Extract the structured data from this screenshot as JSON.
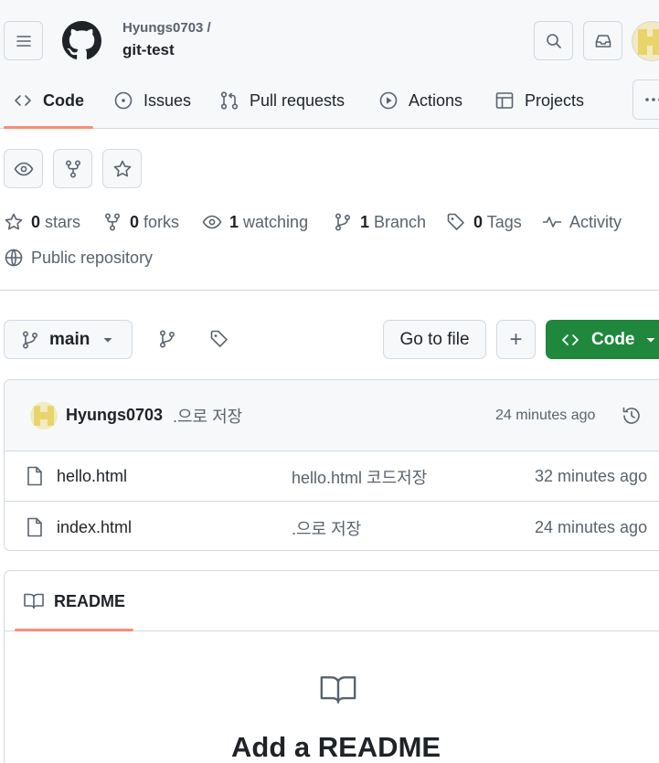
{
  "header": {
    "owner": "Hyungs0703 /",
    "repo": "git-test"
  },
  "tabs": [
    {
      "label": "Code",
      "icon": "code-icon",
      "selected": true
    },
    {
      "label": "Issues",
      "icon": "issue-opened-icon"
    },
    {
      "label": "Pull requests",
      "icon": "git-pull-request-icon"
    },
    {
      "label": "Actions",
      "icon": "play-icon"
    },
    {
      "label": "Projects",
      "icon": "table-icon"
    }
  ],
  "stats": {
    "stars_count": "0",
    "stars_label": "stars",
    "forks_count": "0",
    "forks_label": "forks",
    "watching_count": "1",
    "watching_label": "watching",
    "branch_count": "1",
    "branch_label": "Branch",
    "tags_count": "0",
    "tags_label": "Tags",
    "activity_label": "Activity",
    "visibility": "Public repository"
  },
  "branch_bar": {
    "branch": "main",
    "go_to_file": "Go to file",
    "add": "+",
    "code_label": "Code"
  },
  "latest_commit": {
    "author": "Hyungs0703",
    "message": ".으로 저장",
    "time": "24 minutes ago"
  },
  "files": [
    {
      "name": "hello.html",
      "message": "hello.html 코드저장",
      "time": "32 minutes ago"
    },
    {
      "name": "index.html",
      "message": ".으로 저장",
      "time": "24 minutes ago"
    }
  ],
  "readme": {
    "tab_label": "README",
    "add_title": "Add a README"
  },
  "colors": {
    "accent_underline": "#fd8c73",
    "code_button": "#1f883d",
    "avatar": "#e8d46a"
  }
}
